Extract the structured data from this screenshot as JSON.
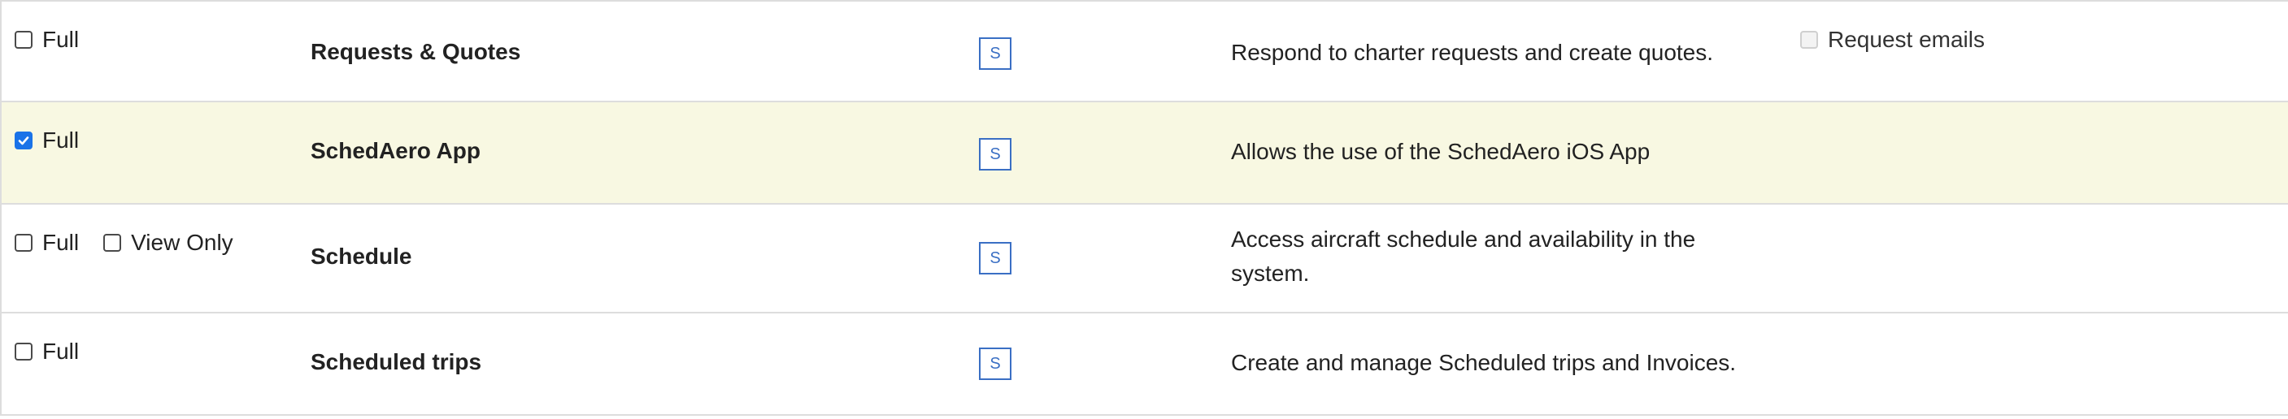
{
  "rows": [
    {
      "options": [
        {
          "label": "Full",
          "checked": false
        }
      ],
      "name": "Requests & Quotes",
      "badge": "S",
      "description": "Respond to charter requests and create quotes.",
      "extra": {
        "label": "Request emails",
        "checked": false,
        "disabled": true
      }
    },
    {
      "options": [
        {
          "label": "Full",
          "checked": true
        }
      ],
      "name": "SchedAero App",
      "badge": "S",
      "description": "Allows the use of the SchedAero iOS App",
      "highlighted": true
    },
    {
      "options": [
        {
          "label": "Full",
          "checked": false
        },
        {
          "label": "View Only",
          "checked": false
        }
      ],
      "name": "Schedule",
      "badge": "S",
      "description": "Access aircraft schedule and availability in the system."
    },
    {
      "options": [
        {
          "label": "Full",
          "checked": false
        }
      ],
      "name": "Scheduled trips",
      "badge": "S",
      "description": "Create and manage Scheduled trips and Invoices."
    }
  ]
}
